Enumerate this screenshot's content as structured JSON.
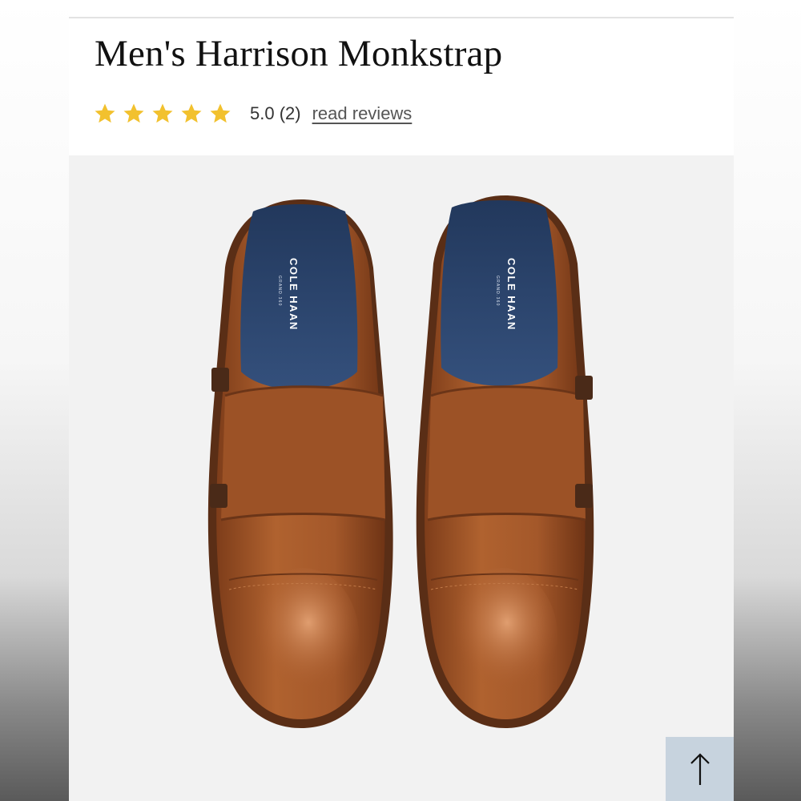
{
  "product": {
    "title": "Men's Harrison Monkstrap"
  },
  "rating": {
    "score_label": "5.0 (2)",
    "stars": 5,
    "star_color": "#f2c12e",
    "reviews_link": "read reviews"
  },
  "image": {
    "brand": "COLE HAAN",
    "sub_brand": "GRAND.360",
    "colors": {
      "leather": "#a85a2c",
      "insole": "#2f4a74",
      "background": "#f2f2f2"
    }
  },
  "controls": {
    "scroll_top_icon": "arrow-up-icon"
  }
}
